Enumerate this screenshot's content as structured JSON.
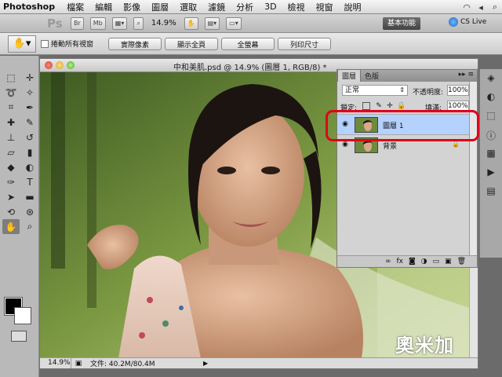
{
  "menubar": {
    "app_name": "Photoshop",
    "items": [
      "檔案",
      "編輯",
      "影像",
      "圖層",
      "選取",
      "濾鏡",
      "分析",
      "3D",
      "檢視",
      "視窗",
      "說明"
    ]
  },
  "appbar": {
    "logo": "Ps",
    "br_label": "Br",
    "mb_label": "Mb",
    "zoom": "14.9%",
    "workspace": "基本功能",
    "cs_live": "CS Live"
  },
  "options": {
    "scroll_all_label": "捲動所有視窗",
    "btn_actual_pixels": "實際像素",
    "btn_fit_screen": "顯示全頁",
    "btn_fill_screen": "全螢幕",
    "btn_print_size": "列印尺寸"
  },
  "document": {
    "title": "中和美肌.psd @ 14.9% (圖層 1, RGB/8) *",
    "status_zoom": "14.9%",
    "status_file": "文件: 40.2M/80.4M"
  },
  "layers_panel": {
    "tab_layers": "圖層",
    "tab_channels": "色版",
    "blend_mode": "正常",
    "opacity_label": "不透明度:",
    "opacity_value": "100%",
    "lock_label": "鎖定:",
    "fill_label": "填滿:",
    "fill_value": "100%",
    "layers": [
      {
        "name": "圖層 1",
        "selected": true
      },
      {
        "name": "背景",
        "selected": false
      }
    ]
  },
  "watermark": "奧米加",
  "colors": {
    "selection": "#b5d2ff",
    "highlight_ring": "#e0001a"
  }
}
